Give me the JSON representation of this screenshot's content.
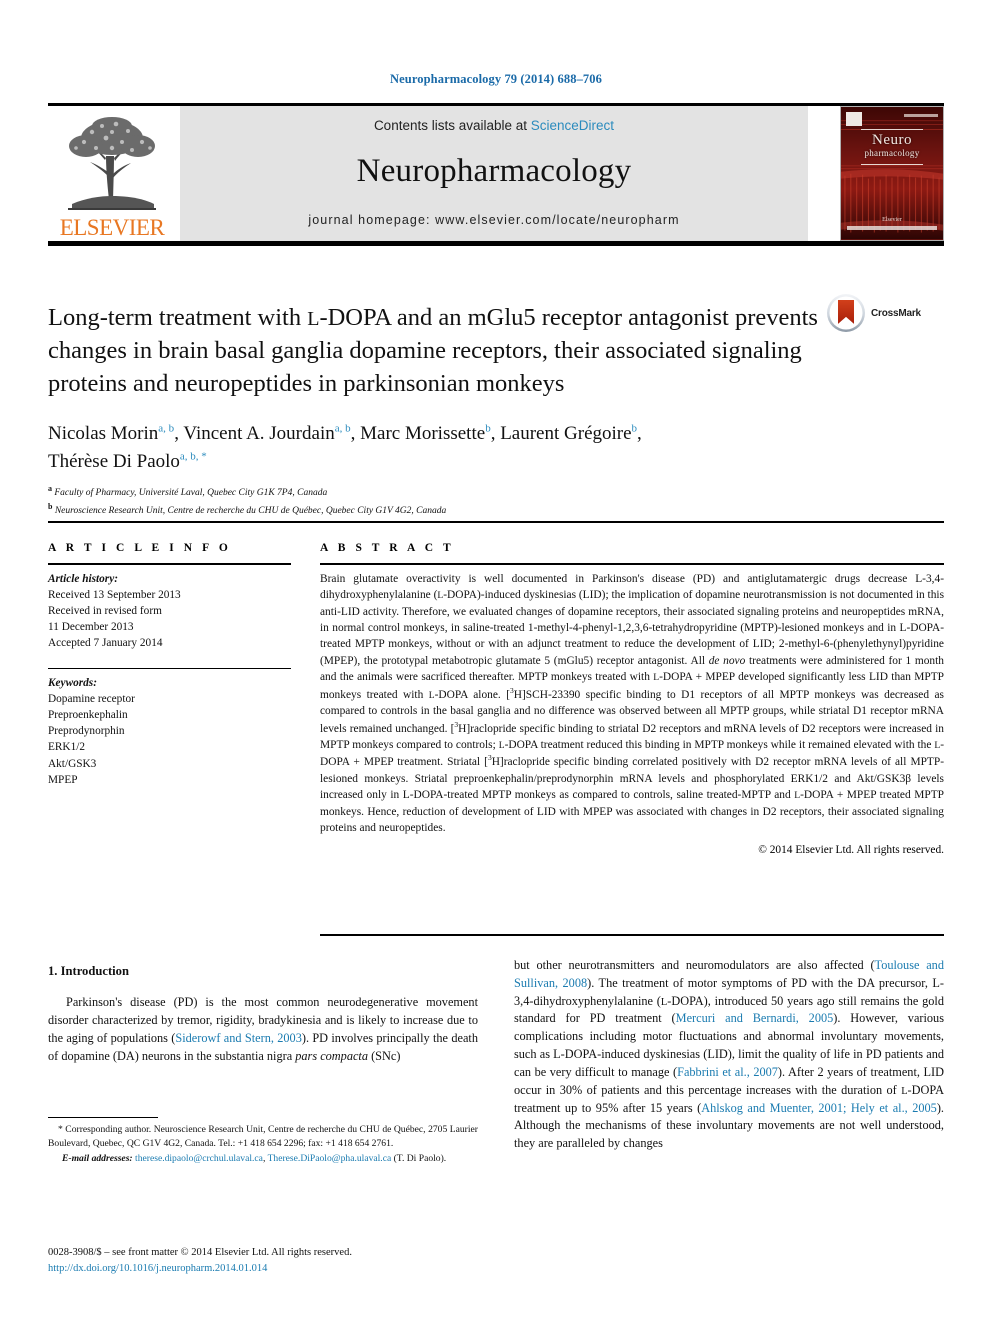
{
  "running_head": "Neuropharmacology 79 (2014) 688–706",
  "masthead": {
    "contents_prefix": "Contents lists available at ",
    "sciencedirect": "ScienceDirect",
    "journal_name": "Neuropharmacology",
    "homepage": "journal homepage: www.elsevier.com/locate/neuropharm",
    "publisher_logo_text": "ELSEVIER",
    "cover_title_main": "Neuro",
    "cover_title_sub": "pharmacology",
    "cover_publisher": "Elsevier",
    "accent_color": "#2b8bbd",
    "elsevier_orange": "#E87722"
  },
  "article": {
    "title": "Long-term treatment with ʟ-DOPA and an mGlu5 receptor antagonist prevents changes in brain basal ganglia dopamine receptors, their associated signaling proteins and neuropeptides in parkinsonian monkeys",
    "crossmark_label": "CrossMark",
    "authors": [
      {
        "name": "Nicolas Morin",
        "marks": "a, b"
      },
      {
        "name": "Vincent A. Jourdain",
        "marks": "a, b"
      },
      {
        "name": "Marc Morissette",
        "marks": "b"
      },
      {
        "name": "Laurent Grégoire",
        "marks": "b"
      },
      {
        "name": "Thérèse Di Paolo",
        "marks": "a, b, *"
      }
    ],
    "affiliations": [
      {
        "mark": "a",
        "text": "Faculty of Pharmacy, Université Laval, Quebec City G1K 7P4, Canada"
      },
      {
        "mark": "b",
        "text": "Neuroscience Research Unit, Centre de recherche du CHU de Québec, Quebec City G1V 4G2, Canada"
      }
    ]
  },
  "article_info": {
    "heading": "A R T I C L E   I N F O",
    "history_label": "Article history:",
    "history_lines": [
      "Received 13 September 2013",
      "Received in revised form",
      "11 December 2013",
      "Accepted 7 January 2014"
    ],
    "keywords_label": "Keywords:",
    "keywords": [
      "Dopamine receptor",
      "Preproenkephalin",
      "Preprodynorphin",
      "ERK1/2",
      "Akt/GSK3",
      "MPEP"
    ]
  },
  "abstract": {
    "heading": "A B S T R A C T",
    "text": "Brain glutamate overactivity is well documented in Parkinson's disease (PD) and antiglutamatergic drugs decrease L-3,4-dihydroxyphenylalanine (ʟ-DOPA)-induced dyskinesias (LID); the implication of dopamine neurotransmission is not documented in this anti-LID activity. Therefore, we evaluated changes of dopamine receptors, their associated signaling proteins and neuropeptides mRNA, in normal control monkeys, in saline-treated 1-methyl-4-phenyl-1,2,3,6-tetrahydropyridine (MPTP)-lesioned monkeys and in L-DOPA-treated MPTP monkeys, without or with an adjunct treatment to reduce the development of LID; 2-methyl-6-(phenylethynyl)pyridine (MPEP), the prototypal metabotropic glutamate 5 (mGlu5) receptor antagonist. All de novo treatments were administered for 1 month and the animals were sacrificed thereafter. MPTP monkeys treated with ʟ-DOPA + MPEP developed significantly less LID than MPTP monkeys treated with ʟ-DOPA alone. [3H]SCH-23390 specific binding to D1 receptors of all MPTP monkeys was decreased as compared to controls in the basal ganglia and no difference was observed between all MPTP groups, while striatal D1 receptor mRNA levels remained unchanged. [3H]raclopride specific binding to striatal D2 receptors and mRNA levels of D2 receptors were increased in MPTP monkeys compared to controls; ʟ-DOPA treatment reduced this binding in MPTP monkeys while it remained elevated with the ʟ-DOPA + MPEP treatment. Striatal [3H]raclopride specific binding correlated positively with D2 receptor mRNA levels of all MPTP-lesioned monkeys. Striatal preproenkephalin/preprodynorphin mRNA levels and phosphorylated ERK1/2 and Akt/GSK3β levels increased only in L-DOPA-treated MPTP monkeys as compared to controls, saline treated-MPTP and ʟ-DOPA + MPEP treated MPTP monkeys. Hence, reduction of development of LID with MPEP was associated with changes in D2 receptors, their associated signaling proteins and neuropeptides.",
    "copyright": "© 2014 Elsevier Ltd. All rights reserved."
  },
  "body": {
    "section_heading": "1. Introduction",
    "left_paragraph": "Parkinson's disease (PD) is the most common neurodegenerative movement disorder characterized by tremor, rigidity, bradykinesia and is likely to increase due to the aging of populations (Siderowf and Stern, 2003). PD involves principally the death of dopamine (DA) neurons in the substantia nigra pars compacta (SNc)",
    "left_refs": [
      "Siderowf and Stern, 2003"
    ],
    "right_paragraph": "but other neurotransmitters and neuromodulators are also affected (Toulouse and Sullivan, 2008). The treatment of motor symptoms of PD with the DA precursor, L-3,4-dihydroxyphenylalanine (ʟ-DOPA), introduced 50 years ago still remains the gold standard for PD treatment (Mercuri and Bernardi, 2005). However, various complications including motor fluctuations and abnormal involuntary movements, such as L-DOPA-induced dyskinesias (LID), limit the quality of life in PD patients and can be very difficult to manage (Fabbrini et al., 2007). After 2 years of treatment, LID occur in 30% of patients and this percentage increases with the duration of ʟ-DOPA treatment up to 95% after 15 years (Ahlskog and Muenter, 2001; Hely et al., 2005). Although the mechanisms of these involuntary movements are not well understood, they are paralleled by changes",
    "right_refs": [
      "Toulouse and Sullivan, 2008",
      "Mercuri and Bernardi, 2005",
      "Fabbrini et al., 2007",
      "Ahlskog and Muenter, 2001; Hely et al., 2005"
    ]
  },
  "footnotes": {
    "corresponding": "* Corresponding author. Neuroscience Research Unit, Centre de recherche du CHU de Québec, 2705 Laurier Boulevard, Quebec, QC G1V 4G2, Canada. Tel.: +1 418 654 2296; fax: +1 418 654 2761.",
    "email_label": "E-mail addresses:",
    "emails": [
      "therese.dipaolo@crchul.ulaval.ca",
      "Therese.DiPaolo@pha.ulaval.ca"
    ],
    "email_attrib": " (T. Di Paolo).",
    "issn_line": "0028-3908/$ – see front matter © 2014 Elsevier Ltd. All rights reserved.",
    "doi": "http://dx.doi.org/10.1016/j.neuropharm.2014.01.014"
  }
}
